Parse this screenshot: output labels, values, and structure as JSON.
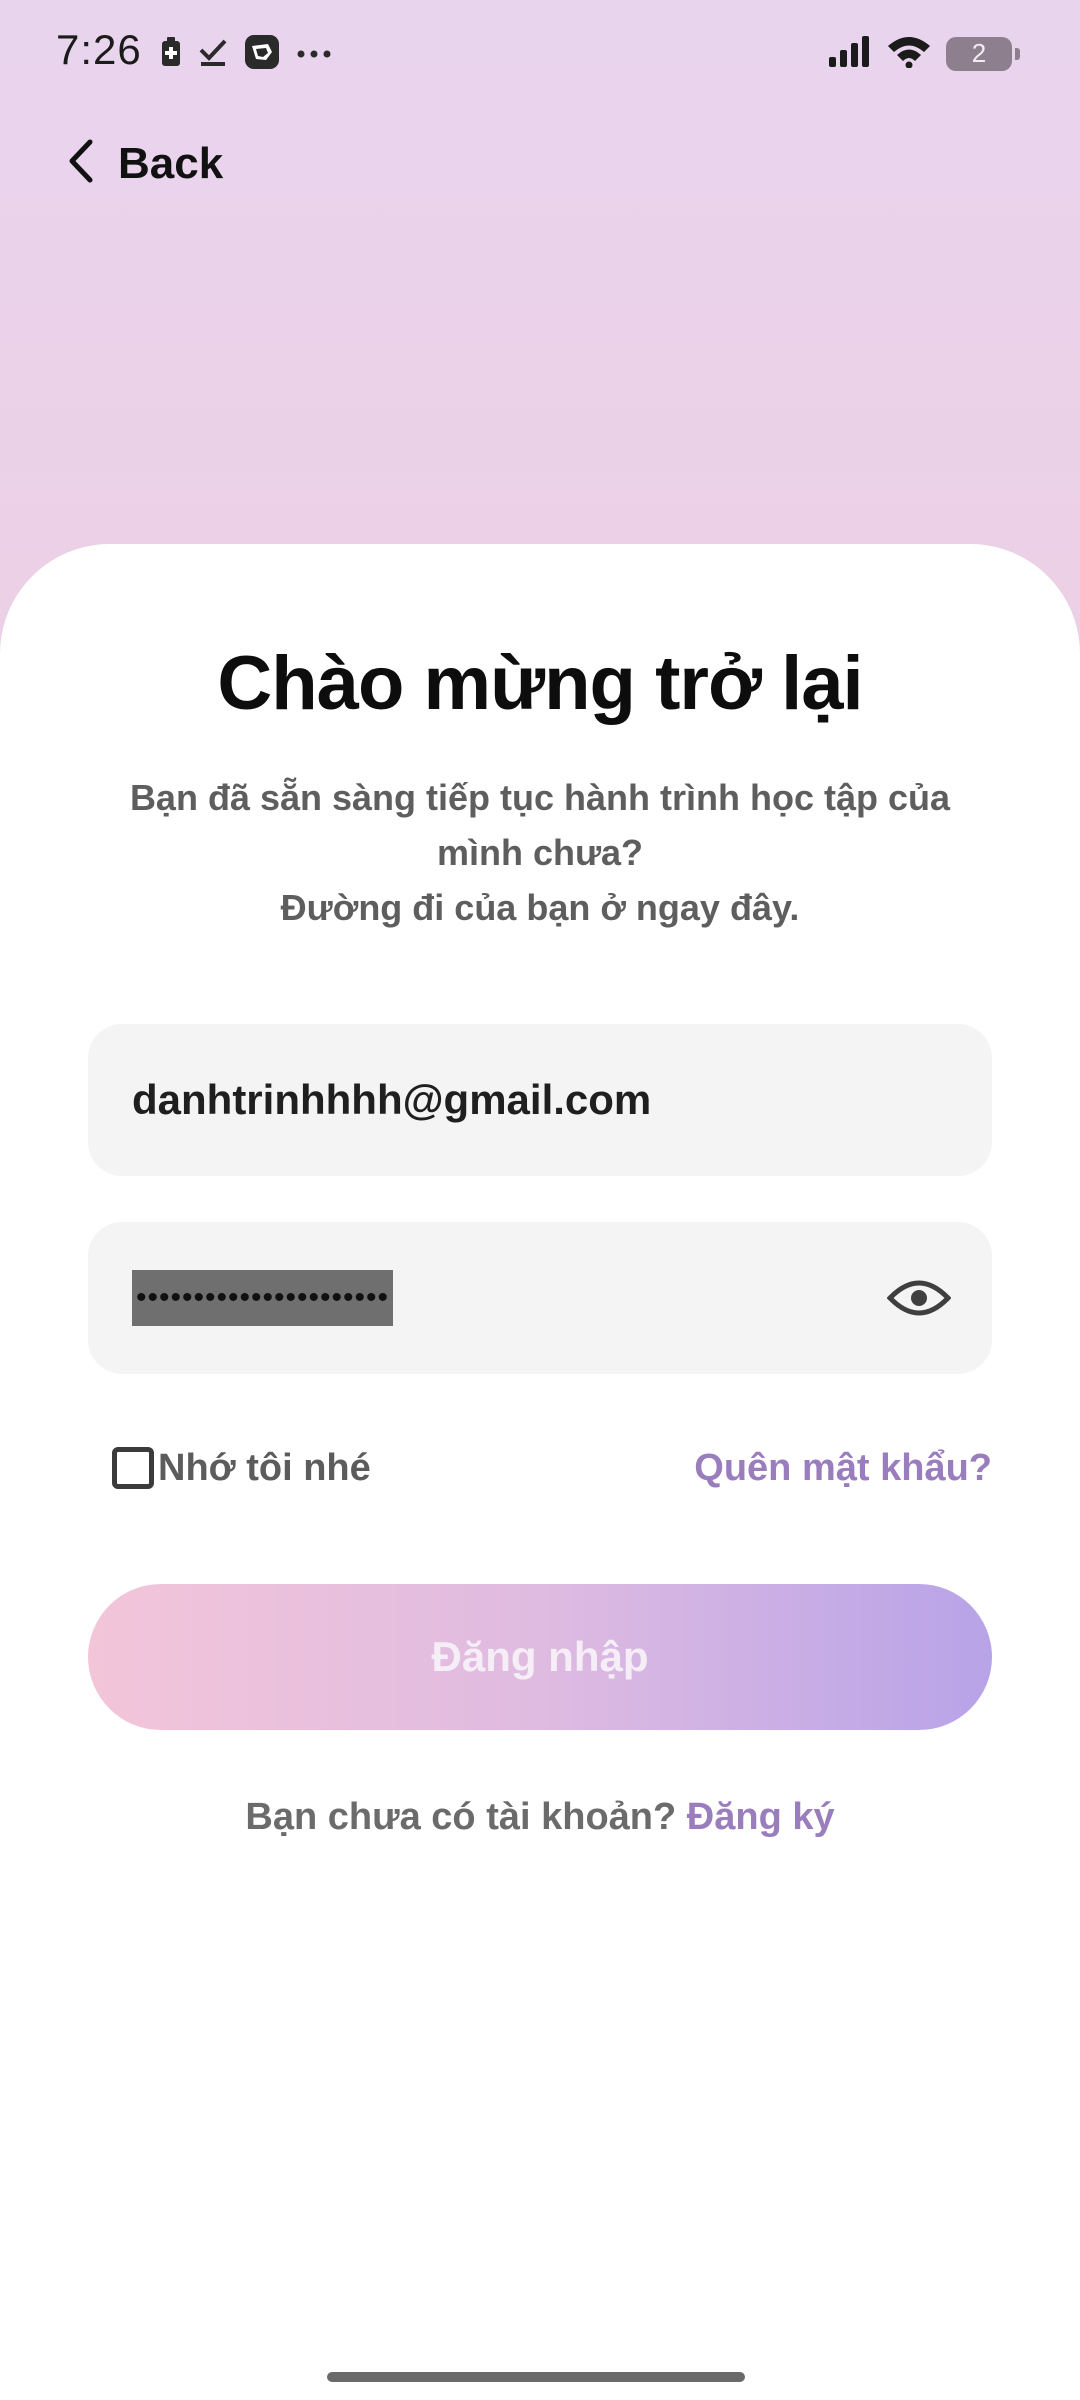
{
  "status_bar": {
    "time": "7:26",
    "battery_level": "2",
    "icons": [
      "battery-saver-icon",
      "check-icon",
      "app-notification-icon",
      "more-notifications-icon",
      "signal-icon",
      "wifi-icon",
      "battery-icon"
    ]
  },
  "nav": {
    "back_label": "Back"
  },
  "header": {
    "title": "Chào mừng trở lại",
    "subtitle_line1": "Bạn đã sẵn sàng tiếp tục hành trình học tập của mình chưa?",
    "subtitle_line2": "Đường đi của bạn ở ngay đây."
  },
  "form": {
    "email_value": "danhtrinhhhh@gmail.com",
    "password_mask": "••••••••••••••••••••••",
    "remember_label": "Nhớ tôi nhé",
    "remember_checked": false,
    "forgot_label": "Quên mật khẩu?",
    "login_label": "Đăng nhập"
  },
  "footer": {
    "signup_prompt": "Bạn chưa có tài khoản?",
    "signup_link": "Đăng ký"
  },
  "colors": {
    "accent": "#9a7dbd",
    "gradient_start": "#f3c5d9",
    "gradient_end": "#b8a3e8",
    "field_bg": "#f4f4f4"
  }
}
